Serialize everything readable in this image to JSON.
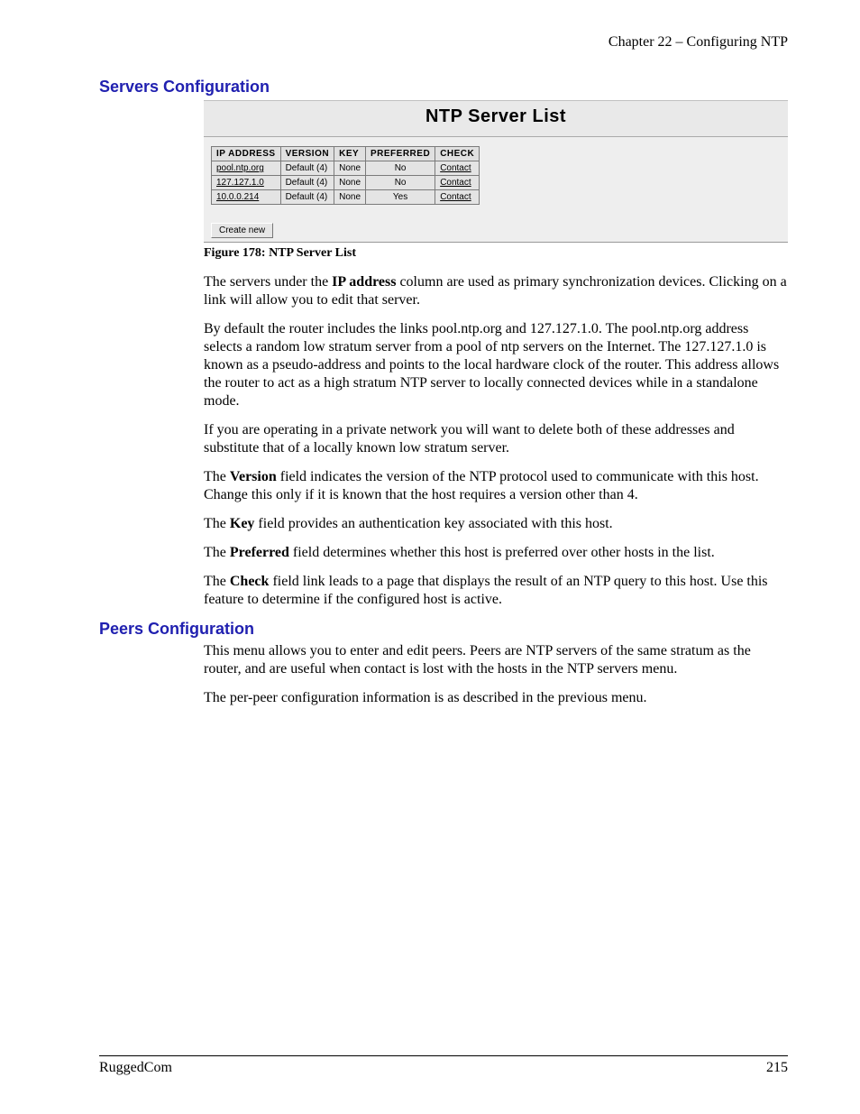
{
  "header": "Chapter 22 – Configuring NTP",
  "section1": {
    "heading": "Servers Configuration",
    "figure_title": "NTP Server List",
    "table": {
      "headers": [
        "IP ADDRESS",
        "VERSION",
        "KEY",
        "PREFERRED",
        "CHECK"
      ],
      "rows": [
        {
          "ip": "pool.ntp.org",
          "version": "Default (4)",
          "key": "None",
          "preferred": "No",
          "check": "Contact"
        },
        {
          "ip": "127.127.1.0",
          "version": "Default (4)",
          "key": "None",
          "preferred": "No",
          "check": "Contact"
        },
        {
          "ip": "10.0.0.214",
          "version": "Default (4)",
          "key": "None",
          "preferred": "Yes",
          "check": "Contact"
        }
      ]
    },
    "create_button": "Create new",
    "caption": "Figure 178: NTP Server List",
    "para1_a": "The servers under the ",
    "para1_b": "IP address",
    "para1_c": " column are used as primary synchronization devices.  Clicking on a link will allow you to edit that server.",
    "para2": "By default the router includes the links pool.ntp.org and 127.127.1.0.  The pool.ntp.org address selects a random low stratum server from a pool of ntp servers on the Internet.  The 127.127.1.0 is known as a pseudo-address and points to the local hardware clock of the router.  This address allows the router to act as a high stratum NTP server to locally connected devices while in a standalone mode.",
    "para3": "If you are operating in a private network you will want to delete both of these addresses and substitute that of a locally known low stratum server.",
    "para4_a": "The ",
    "para4_b": "Version",
    "para4_c": " field indicates the version of the NTP protocol used to communicate with this host.  Change this only if it is known that the host requires a version other than 4.",
    "para5_a": "The ",
    "para5_b": "Key",
    "para5_c": " field provides an authentication key associated with this host.",
    "para6_a": "The ",
    "para6_b": "Preferred",
    "para6_c": " field determines whether this host is preferred over other hosts in the list.",
    "para7_a": "The ",
    "para7_b": "Check",
    "para7_c": " field link leads to a page that displays the result of an NTP query to this host.  Use this feature to determine if the configured host is active."
  },
  "section2": {
    "heading": "Peers Configuration",
    "para1": "This menu allows you to enter and edit peers.  Peers are NTP servers of the same stratum as the router, and are useful when contact is lost with the hosts in the NTP servers menu.",
    "para2": "The per-peer configuration information is as described in the previous menu."
  },
  "footer": {
    "left": "RuggedCom",
    "right": "215"
  }
}
